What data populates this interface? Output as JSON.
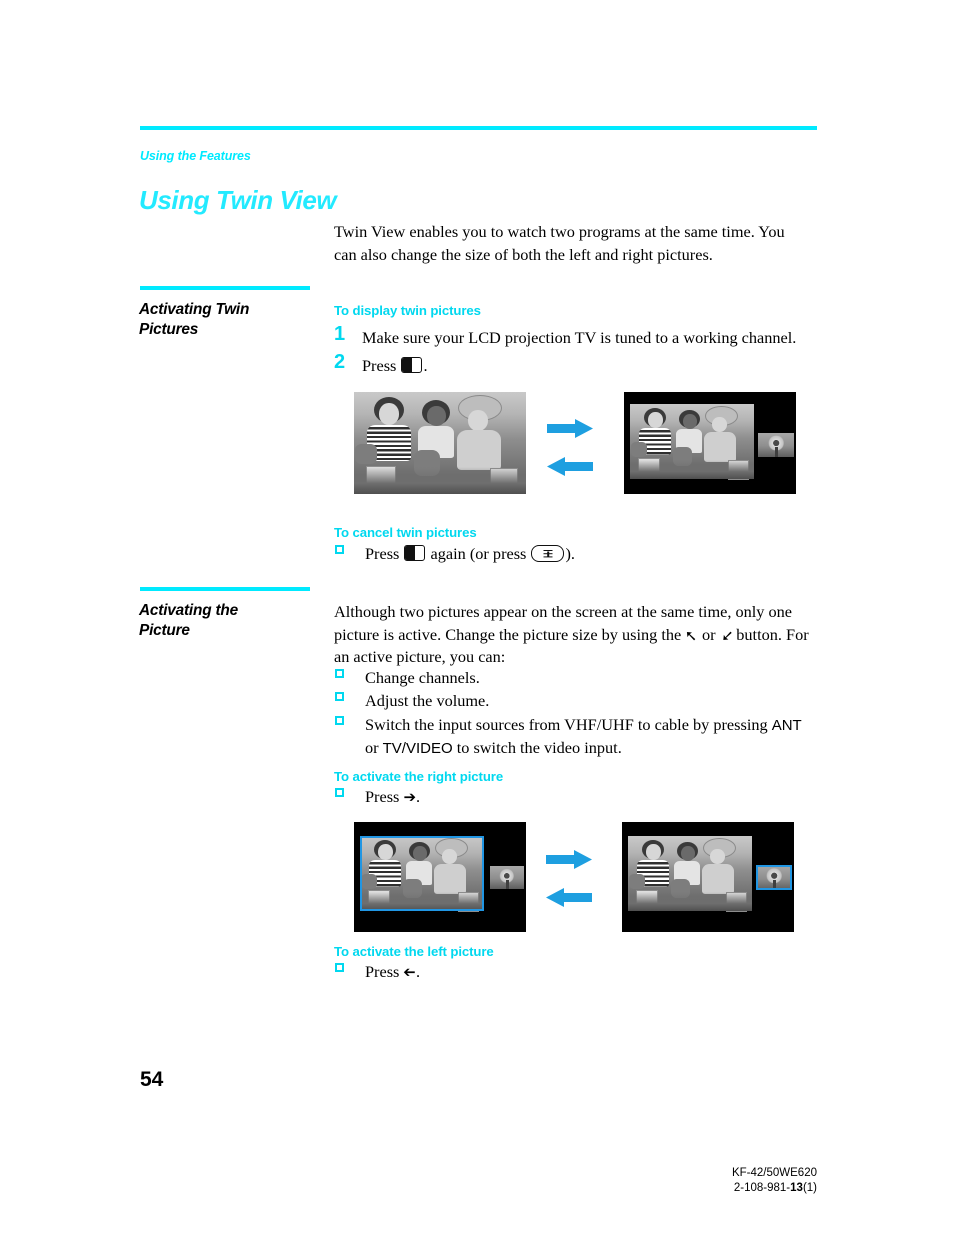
{
  "theme": {
    "accent_cyan": "#00eaff",
    "heading_cyan": "#23eaff",
    "subhead_cyan": "#00d8ef",
    "arrow_blue": "#1e9fe0",
    "highlight_blue": "#2196e3"
  },
  "running_head": "Using the Features",
  "chapter_title": "Using Twin View",
  "intro": "Twin View enables you to watch two programs at the same time. You can also change the size of both the left and right pictures.",
  "sections": {
    "activating_twin_pictures": {
      "side_heading_line1": "Activating Twin",
      "side_heading_line2": "Pictures",
      "sub_display": "To display twin pictures",
      "steps": [
        {
          "number": "1",
          "text": "Make sure your LCD projection TV is tuned to a working channel."
        },
        {
          "number": "2",
          "text_before": "Press",
          "text_after": "."
        }
      ],
      "sub_cancel": "To cancel twin pictures",
      "cancel_text_1": "Press",
      "cancel_text_2": "again (or press",
      "cancel_text_3": ")."
    },
    "activating_the_picture": {
      "side_heading_line1": "Activating the",
      "side_heading_line2": "Picture",
      "body_1": "Although two pictures appear on the screen at the same time, only one picture is active. Change the picture size by using the",
      "body_or": "or",
      "body_2": "button. For an active picture, you can:",
      "up_arrow": "✦",
      "down_arrow": "✦",
      "bullets": [
        "Change channels.",
        "Adjust the volume."
      ],
      "bullet_switch_part1": "Switch the input sources from VHF/UHF to cable by pressing ",
      "bullet_switch_ant": "ANT",
      "bullet_switch_part2": " or ",
      "bullet_switch_tvvideo": "TV/VIDEO",
      "bullet_switch_part3": " to switch the video input.",
      "sub_activate_right": "To activate the right picture",
      "activate_right_text": "Press",
      "activate_right_arrow": "➜",
      "sub_activate_left": "To activate the left picture",
      "activate_left_text": "Press",
      "activate_left_arrow": "➜"
    }
  },
  "figures": {
    "figure_1": {
      "caption": "single picture transforms to twin pictures",
      "left_tv": "full-screen single picture",
      "right_tv": "twin view: large left picture with small right picture",
      "arrow_right": "forward",
      "arrow_left": "backward"
    },
    "figure_2": {
      "caption": "active picture switches from left to right",
      "left_tv": "twin view with left picture highlighted",
      "right_tv": "twin view with right picture highlighted",
      "arrow_right": "forward",
      "arrow_left": "backward"
    }
  },
  "page_number": "54",
  "footer": {
    "model": "KF-42/50WE620",
    "doc_prefix": "2-108-981-",
    "doc_bold": "13",
    "doc_suffix": "(1)"
  }
}
